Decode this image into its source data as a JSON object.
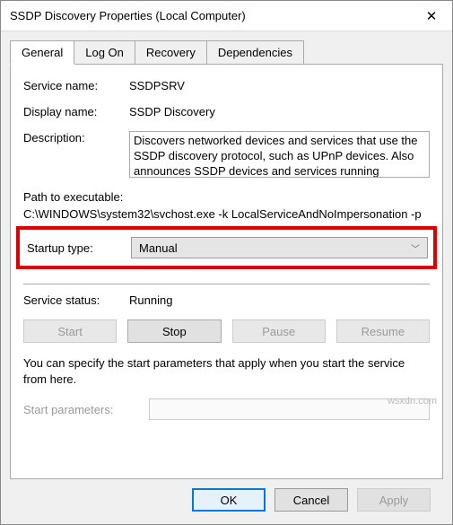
{
  "window": {
    "title": "SSDP Discovery Properties (Local Computer)"
  },
  "tabs": [
    {
      "label": "General"
    },
    {
      "label": "Log On"
    },
    {
      "label": "Recovery"
    },
    {
      "label": "Dependencies"
    }
  ],
  "general": {
    "serviceNameLabel": "Service name:",
    "serviceName": "SSDPSRV",
    "displayNameLabel": "Display name:",
    "displayName": "SSDP Discovery",
    "descriptionLabel": "Description:",
    "description": "Discovers networked devices and services that use the SSDP discovery protocol, such as UPnP devices. Also announces SSDP devices and services running",
    "pathLabel": "Path to executable:",
    "path": "C:\\WINDOWS\\system32\\svchost.exe -k LocalServiceAndNoImpersonation -p",
    "startupTypeLabel": "Startup type:",
    "startupType": "Manual",
    "serviceStatusLabel": "Service status:",
    "serviceStatus": "Running",
    "buttons": {
      "start": "Start",
      "stop": "Stop",
      "pause": "Pause",
      "resume": "Resume"
    },
    "hint": "You can specify the start parameters that apply when you start the service from here.",
    "startParamsLabel": "Start parameters:",
    "startParams": ""
  },
  "footer": {
    "ok": "OK",
    "cancel": "Cancel",
    "apply": "Apply"
  },
  "watermark": "wsxdn.com"
}
